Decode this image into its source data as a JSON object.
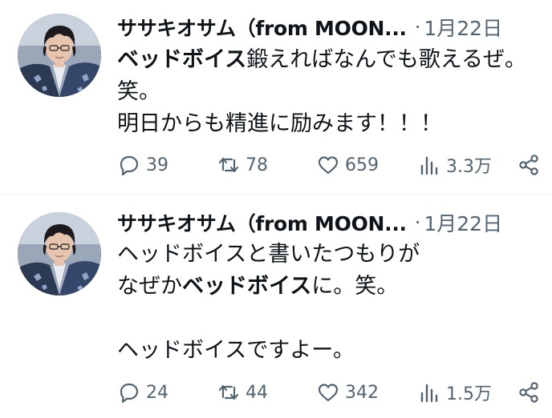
{
  "tweets": [
    {
      "author": {
        "display_name": "ササキオサム（from MOON...",
        "avatar_icon": "profile-photo"
      },
      "timestamp": "1月22日",
      "separator": "·",
      "body": {
        "line1_bold": "ベッドボイス",
        "line1_rest": "鍛えればなんでも歌えるぜ。",
        "line2": "笑。",
        "line3": "明日からも精進に励みます！！！"
      },
      "stats": {
        "replies": "39",
        "retweets": "78",
        "likes": "659",
        "views": "3.3万"
      }
    },
    {
      "author": {
        "display_name": "ササキオサム（from MOON...",
        "avatar_icon": "profile-photo"
      },
      "timestamp": "1月22日",
      "separator": "·",
      "body": {
        "line1": "ヘッドボイスと書いたつもりが",
        "line2_pre": "なぜか",
        "line2_bold": "ベッドボイス",
        "line2_post": "に。笑。",
        "line3": "",
        "line4": "ヘッドボイスですよー。"
      },
      "stats": {
        "replies": "24",
        "retweets": "44",
        "likes": "342",
        "views": "1.5万"
      }
    }
  ],
  "icons": {
    "reply": "reply-icon",
    "retweet": "retweet-icon",
    "like": "heart-icon",
    "views": "views-icon",
    "share": "share-icon"
  },
  "colors": {
    "text_primary": "#0f1419",
    "text_secondary": "#536471",
    "divider": "#eff3f4"
  }
}
